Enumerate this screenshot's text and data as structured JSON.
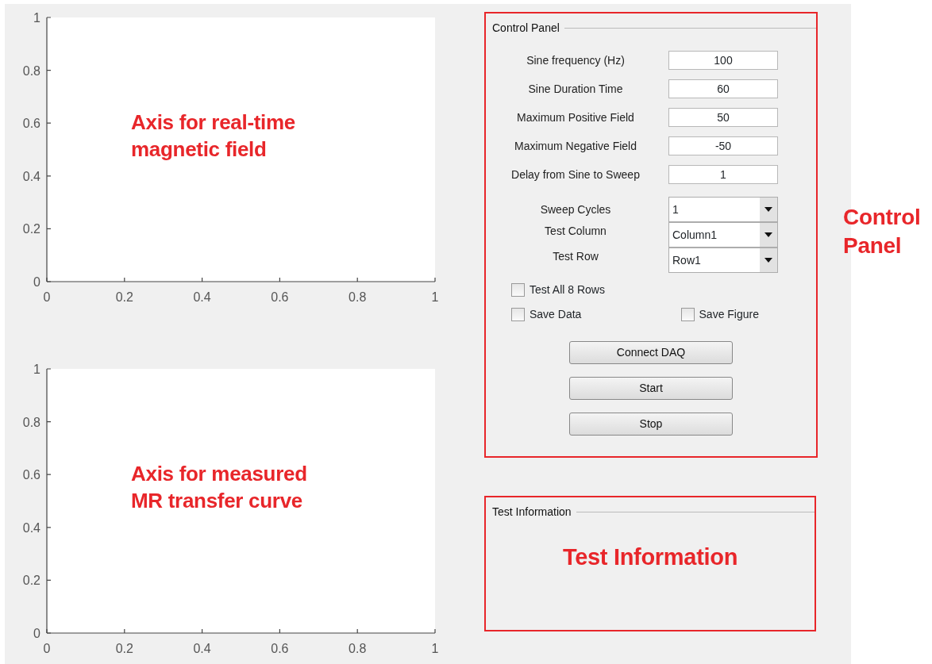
{
  "plots": [
    {
      "annotation": "Axis for real-time magnetic field",
      "chart_data": {
        "type": "line",
        "xlim": [
          0,
          1
        ],
        "ylim": [
          0,
          1
        ],
        "xticks": [
          0,
          0.2,
          0.4,
          0.6,
          0.8,
          1
        ],
        "yticks": [
          0,
          0.2,
          0.4,
          0.6,
          0.8,
          1
        ]
      }
    },
    {
      "annotation": "Axis for measured MR transfer curve",
      "chart_data": {
        "type": "line",
        "xlim": [
          0,
          1
        ],
        "ylim": [
          0,
          1
        ],
        "xticks": [
          0,
          0.2,
          0.4,
          0.6,
          0.8,
          1
        ],
        "yticks": [
          0,
          0.2,
          0.4,
          0.6,
          0.8,
          1
        ]
      }
    }
  ],
  "control_panel": {
    "title": "Control Panel",
    "fields": [
      {
        "label": "Sine frequency (Hz)",
        "value": "100"
      },
      {
        "label": "Sine Duration Time",
        "value": "60"
      },
      {
        "label": "Maximum Positive Field",
        "value": "50"
      },
      {
        "label": "Maximum Negative Field",
        "value": "-50"
      },
      {
        "label": "Delay from Sine to Sweep",
        "value": "1"
      }
    ],
    "dropdowns": [
      {
        "label": "Sweep Cycles",
        "value": "1"
      },
      {
        "label": "Test Column",
        "value": "Column1"
      },
      {
        "label": "Test Row",
        "value": "Row1"
      }
    ],
    "checkboxes": [
      {
        "label": "Test All 8 Rows",
        "checked": false
      },
      {
        "label": "Save Data",
        "checked": false
      },
      {
        "label": "Save Figure",
        "checked": false
      }
    ],
    "buttons": [
      "Connect DAQ",
      "Start",
      "Stop"
    ]
  },
  "control_panel_annotation": "Control Panel",
  "test_information": {
    "title": "Test Information",
    "annotation": "Test Information"
  }
}
